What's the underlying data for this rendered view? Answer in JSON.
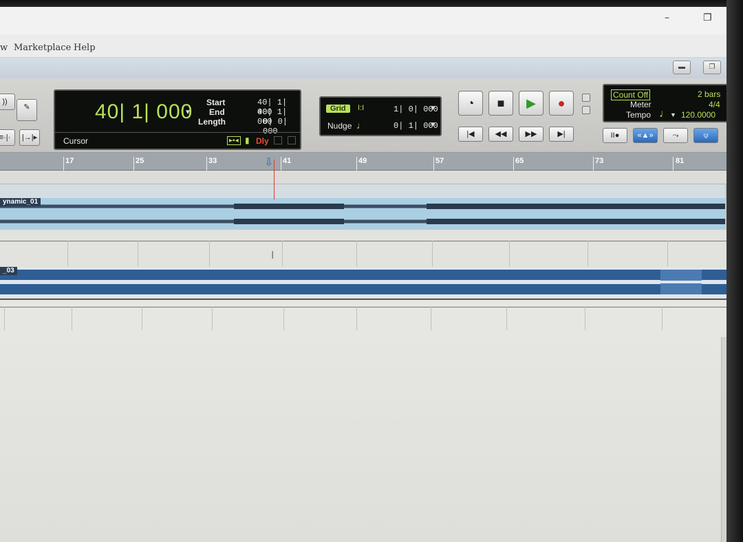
{
  "menu": {
    "items": [
      "Marketplace",
      "Help"
    ]
  },
  "os_window": {
    "minimize": "–",
    "restore": "❐"
  },
  "transport": {
    "main_counter": "40| 1| 000",
    "cursor_label": "Cursor",
    "start_label": "Start",
    "start_value": "40| 1| 000",
    "end_label": "End",
    "end_value": "40| 1| 000",
    "length_label": "Length",
    "length_value": "0| 0| 000",
    "dly_label": "Dly",
    "grid_label": "Grid",
    "grid_value": "1| 0| 000",
    "nudge_label": "Nudge",
    "nudge_value": "0| 1| 000",
    "count_off": "Count Off",
    "bars": "2 bars",
    "meter_label": "Meter",
    "meter_value": "4/4",
    "tempo_label": "Tempo",
    "tempo_value": "120.0000"
  },
  "ruler": {
    "bars": [
      "17",
      "25",
      "33",
      "41",
      "49",
      "57",
      "65",
      "73",
      "81"
    ]
  },
  "tracks": [
    {
      "clip_name": "ynamic_01"
    },
    {
      "clip_name": "_03"
    }
  ],
  "colors": {
    "lcd_green": "#b9e05a",
    "clip_blue": "#2f5e95",
    "playhead": "#e0392b",
    "dly_red": "#e64a3a"
  }
}
